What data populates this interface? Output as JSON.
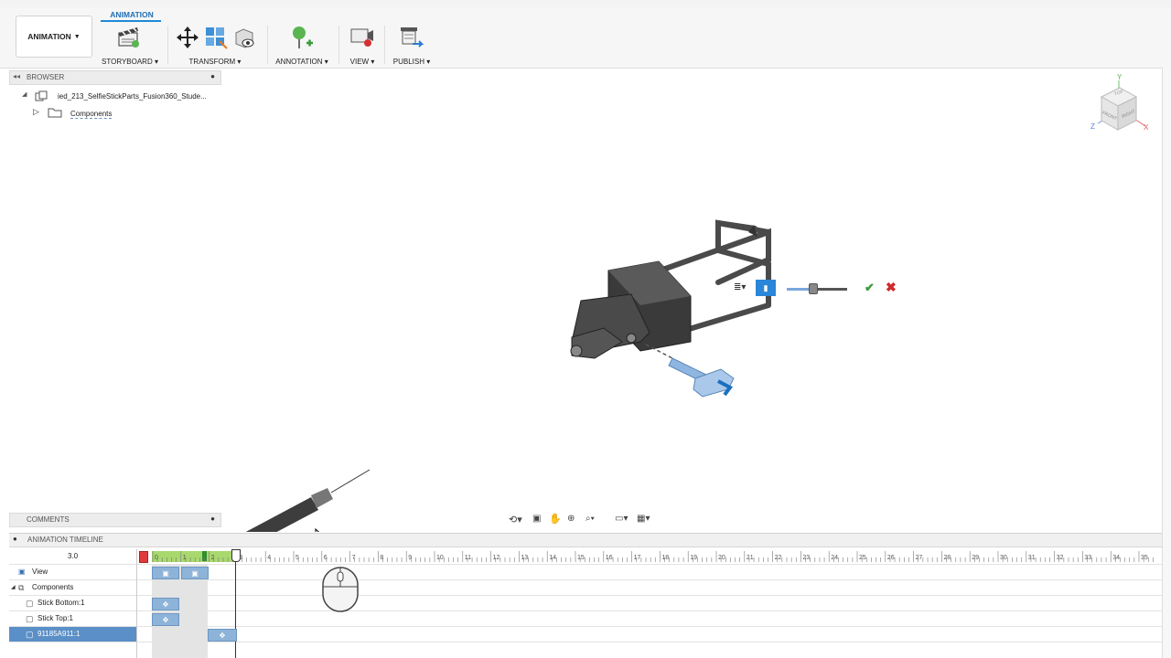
{
  "app": {
    "window_title": "...ed_213_SelfieStickParts_Fusion360_Student...",
    "active_tab": "ANIMATION"
  },
  "toolbar": {
    "workspace_label": "ANIMATION",
    "groups": [
      {
        "label": "STORYBOARD",
        "icon": "storyboard-clapper-icon"
      },
      {
        "label": "TRANSFORM",
        "icon": "move-arrows-icon"
      },
      {
        "label": "ANNOTATION",
        "icon": "callout-pin-icon"
      },
      {
        "label": "VIEW",
        "icon": "record-view-icon"
      },
      {
        "label": "PUBLISH",
        "icon": "publish-video-icon"
      }
    ]
  },
  "browser": {
    "title": "BROWSER",
    "root_label": "ied_213_SelfieStickParts_Fusion360_Stude...",
    "components_label": "Components"
  },
  "comments": {
    "title": "COMMENTS"
  },
  "viewcube": {
    "top": "TOP",
    "front": "FRONT",
    "right": "RIGHT",
    "axis_x": "X",
    "axis_y": "Y",
    "axis_z": "Z"
  },
  "canvas_popup": {
    "confirm_icon": "check-icon",
    "cancel_icon": "close-icon",
    "slider_value": 0.5
  },
  "timeline": {
    "title": "ANIMATION TIMELINE",
    "current_time": "3.0",
    "ruler_ticks": [
      "0",
      "1",
      "2",
      "3",
      "4",
      "5",
      "6",
      "7",
      "8",
      "9",
      "10",
      "11",
      "12",
      "13",
      "14",
      "15",
      "16",
      "17",
      "18",
      "19",
      "20",
      "21",
      "22",
      "23",
      "24",
      "25",
      "26",
      "27",
      "28",
      "29",
      "30",
      "31",
      "32",
      "33",
      "34",
      "35"
    ],
    "rows": [
      {
        "label": "View",
        "icon": "camera-icon",
        "indent": 0
      },
      {
        "label": "Components",
        "icon": "components-icon",
        "indent": 0,
        "expanded": true
      },
      {
        "label": "Stick Bottom:1",
        "icon": "component-icon",
        "indent": 1
      },
      {
        "label": "Stick Top:1",
        "icon": "component-icon",
        "indent": 1
      },
      {
        "label": "91185A911:1",
        "icon": "component-icon",
        "indent": 1,
        "selected": true
      }
    ],
    "colors": {
      "selected_row": "#5b8fc7",
      "keyframe": "#8db3d8",
      "played_range": "#a9d86e"
    }
  }
}
